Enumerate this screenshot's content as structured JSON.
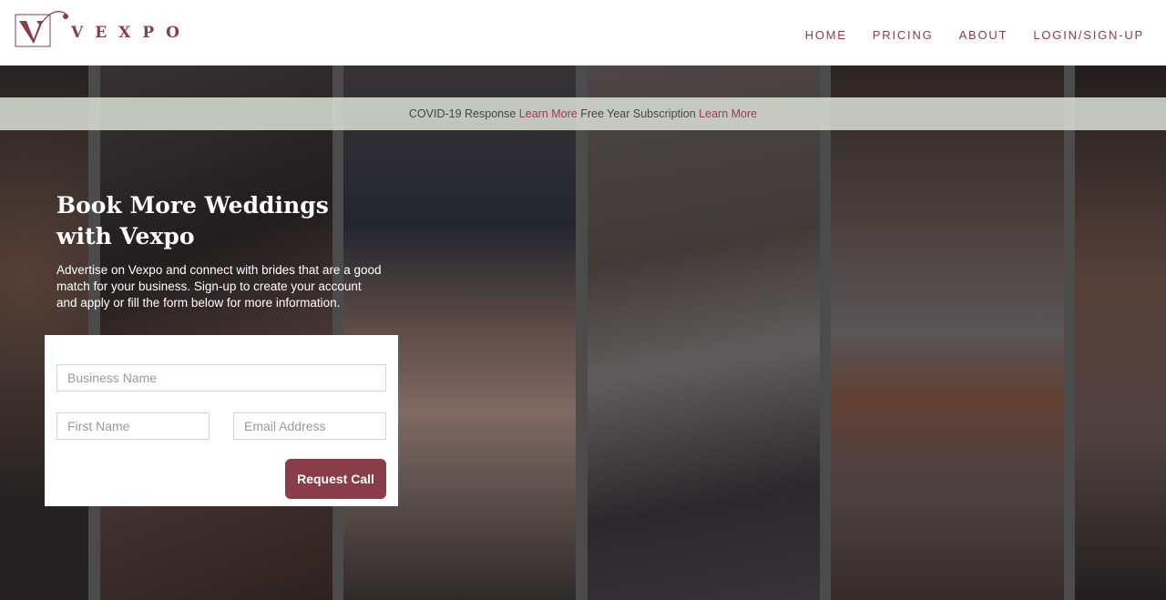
{
  "brand": {
    "name": "VEXPO",
    "logo_icon": "v-monogram-logo-icon",
    "color": "#8a3d48"
  },
  "nav": {
    "items": [
      {
        "label": "HOME"
      },
      {
        "label": "PRICING"
      },
      {
        "label": "ABOUT"
      },
      {
        "label": "LOGIN/SIGN-UP"
      }
    ]
  },
  "banner": {
    "text1": "COVID-19 Response",
    "link1": "Learn More",
    "text2": "Free Year Subscription",
    "link2": "Learn More",
    "link_color": "#a23a4c"
  },
  "hero": {
    "headline": "Book More Weddings with Vexpo",
    "subcopy": "Advertise on Vexpo and connect with brides that are a good match for your business. Sign-up to create your account and apply or fill the form below for more information."
  },
  "form": {
    "business_name": {
      "value": "",
      "placeholder": "Business Name"
    },
    "first_name": {
      "value": "",
      "placeholder": "First Name"
    },
    "email": {
      "value": "",
      "placeholder": "Email Address"
    },
    "submit_label": "Request Call"
  }
}
